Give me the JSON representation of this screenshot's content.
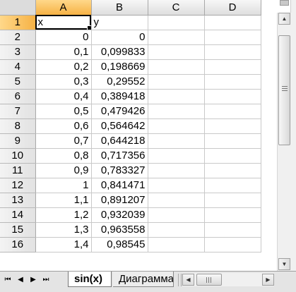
{
  "columns": [
    "A",
    "B",
    "C",
    "D"
  ],
  "rows": [
    {
      "n": "1",
      "a": "x",
      "b": "y"
    },
    {
      "n": "2",
      "a": "0",
      "b": "0"
    },
    {
      "n": "3",
      "a": "0,1",
      "b": "0,099833"
    },
    {
      "n": "4",
      "a": "0,2",
      "b": "0,198669"
    },
    {
      "n": "5",
      "a": "0,3",
      "b": "0,29552"
    },
    {
      "n": "6",
      "a": "0,4",
      "b": "0,389418"
    },
    {
      "n": "7",
      "a": "0,5",
      "b": "0,479426"
    },
    {
      "n": "8",
      "a": "0,6",
      "b": "0,564642"
    },
    {
      "n": "9",
      "a": "0,7",
      "b": "0,644218"
    },
    {
      "n": "10",
      "a": "0,8",
      "b": "0,717356"
    },
    {
      "n": "11",
      "a": "0,9",
      "b": "0,783327"
    },
    {
      "n": "12",
      "a": "1",
      "b": "0,841471"
    },
    {
      "n": "13",
      "a": "1,1",
      "b": "0,891207"
    },
    {
      "n": "14",
      "a": "1,2",
      "b": "0,932039"
    },
    {
      "n": "15",
      "a": "1,3",
      "b": "0,963558"
    },
    {
      "n": "16",
      "a": "1,4",
      "b": "0,98545"
    }
  ],
  "tabs": {
    "active": "sin(x)",
    "other": "Диаграмма"
  },
  "nav": {
    "first": "⏮",
    "prev": "◀",
    "next": "▶",
    "last": "⏭"
  },
  "colors": {
    "selected_header": "#f6b245",
    "grid_line": "#c9c9c9"
  },
  "icons": {
    "scroll_up": "scroll-up-arrow-icon",
    "scroll_down": "scroll-down-arrow-icon",
    "scroll_left": "scroll-left-arrow-icon",
    "scroll_right": "scroll-right-arrow-icon"
  }
}
